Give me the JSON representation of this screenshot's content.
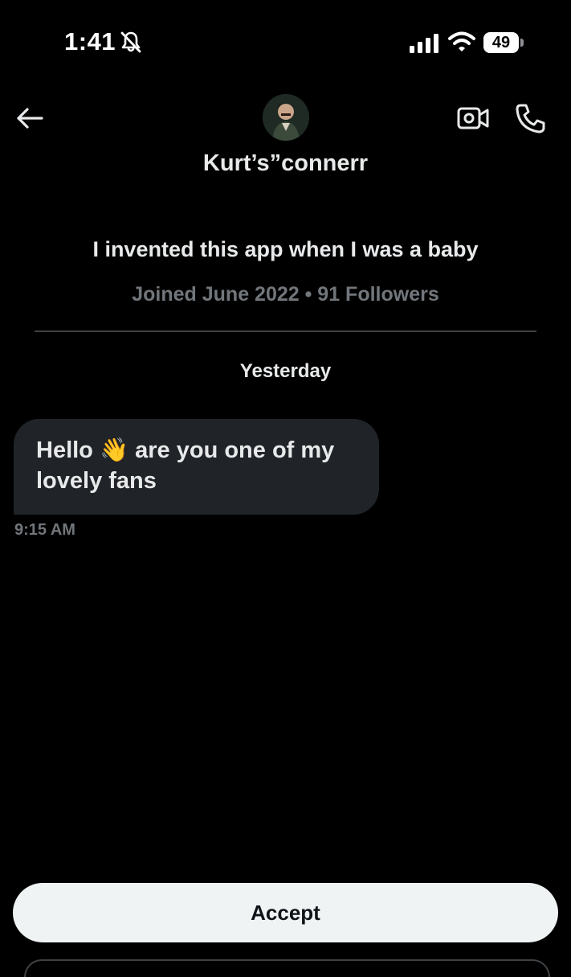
{
  "status_bar": {
    "time": "1:41",
    "battery": "49",
    "icons": [
      "bell-slash-icon",
      "signal-icon",
      "wifi-icon",
      "battery-icon"
    ]
  },
  "header": {
    "contact_name": "Kurt’s”connerr",
    "icons": [
      "back-arrow-icon",
      "video-call-icon",
      "phone-call-icon"
    ]
  },
  "profile": {
    "bio": "I invented this app when I was a baby",
    "meta": "Joined June 2022 • 91 Followers"
  },
  "conversation": {
    "date_separator": "Yesterday",
    "messages": [
      {
        "text": "Hello 👋 are you one of my lovely fans",
        "time": "9:15 AM",
        "direction": "incoming"
      }
    ]
  },
  "actions": {
    "accept_label": "Accept"
  },
  "colors": {
    "background": "#000000",
    "primary_text": "#e7e9ea",
    "secondary_text": "#71767b",
    "bubble": "#202327",
    "accept_button": "#eff3f4"
  }
}
